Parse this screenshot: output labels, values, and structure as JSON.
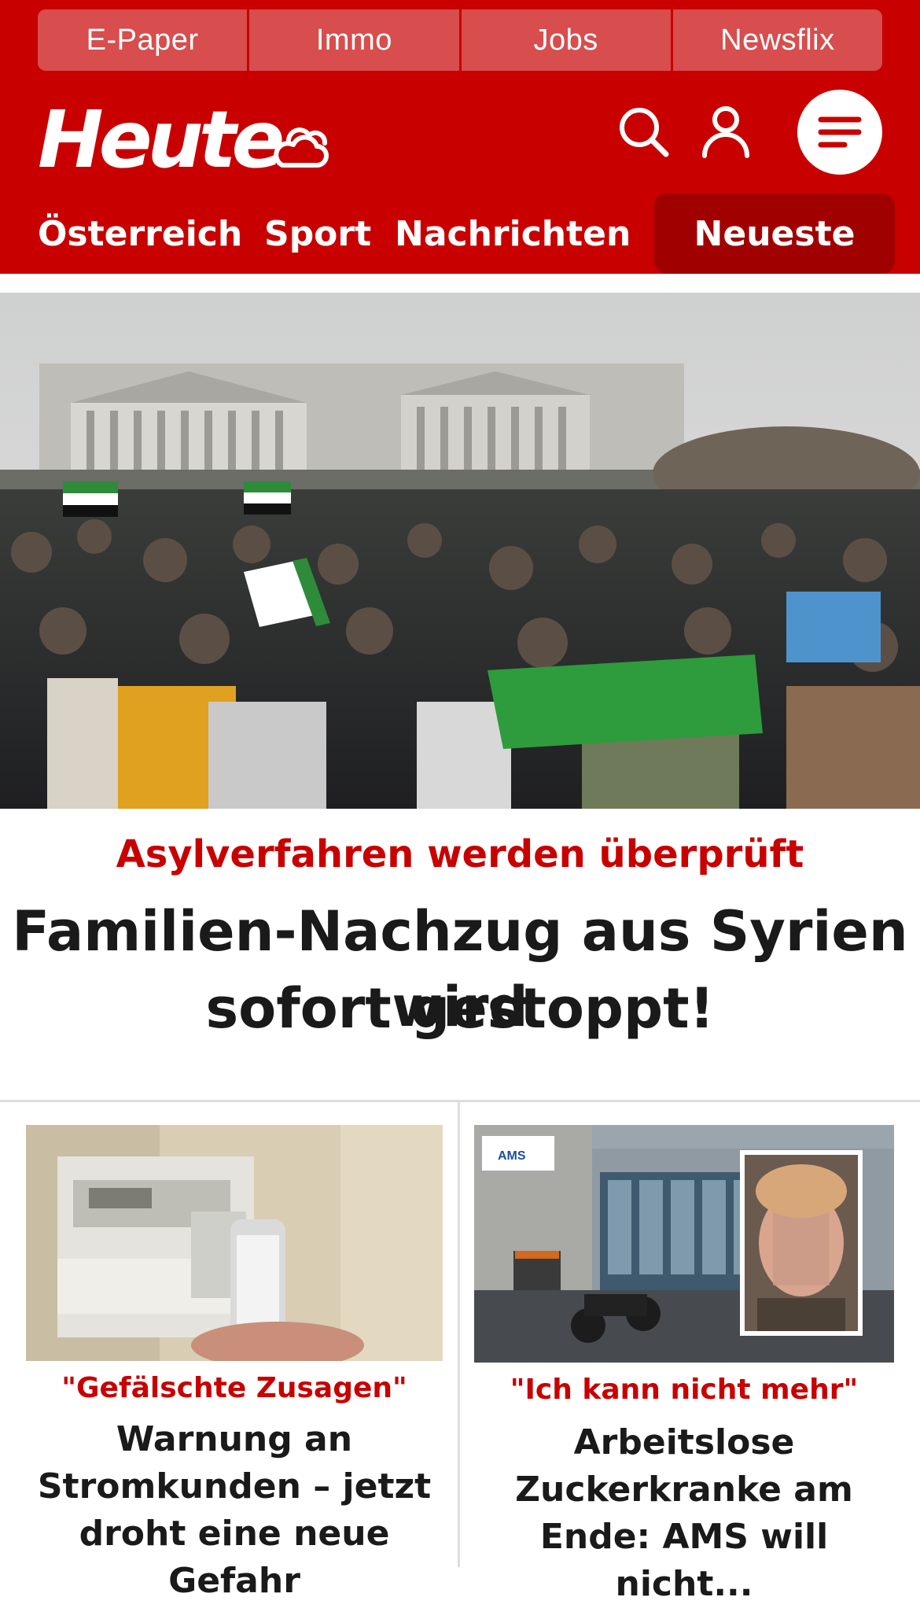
{
  "topbar": {
    "items": [
      "E-Paper",
      "Immo",
      "Jobs",
      "Newsflix"
    ]
  },
  "brand": {
    "logo_text": "Heute",
    "color": "#c80000"
  },
  "header_icons": [
    "cloud-weather-icon",
    "search-icon",
    "user-icon",
    "menu-icon"
  ],
  "nav": {
    "items": [
      "Österreich",
      "Sport",
      "Nachrichten",
      "Neueste"
    ],
    "active": "Neueste"
  },
  "lead": {
    "kicker": "Asylverfahren werden überprüft",
    "headline_line1": "Familien-Nachzug aus Syrien wird",
    "headline_line2": "sofort gestoppt!"
  },
  "cards": [
    {
      "kicker": "\"Gefälschte Zusagen\"",
      "title_lines": [
        "Warnung an",
        "Stromkunden – jetzt",
        "droht eine neue Gefahr"
      ]
    },
    {
      "kicker": "\"Ich kann nicht mehr\"",
      "title_lines": [
        "Arbeitslose",
        "Zuckerkranke am",
        "Ende: AMS will nicht..."
      ]
    }
  ],
  "card_image_text": {
    "ams_sign": "AMS"
  }
}
